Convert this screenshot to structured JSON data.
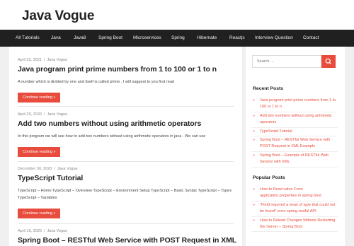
{
  "site": {
    "title": "Java Vogue"
  },
  "nav": {
    "items": [
      {
        "label": "All Tutorials",
        "name": "nav-item-all-tutorials"
      },
      {
        "label": "Java",
        "name": "nav-item-java"
      },
      {
        "label": "Java8",
        "name": "nav-item-java8"
      },
      {
        "label": "Spring Boot",
        "name": "nav-item-spring-boot"
      },
      {
        "label": "Microservices",
        "name": "nav-item-microservices"
      },
      {
        "label": "Spring",
        "name": "nav-item-spring"
      },
      {
        "label": "Hibernate",
        "name": "nav-item-hibernate"
      },
      {
        "label": "Reactjs",
        "name": "nav-item-reactjs"
      },
      {
        "label": "Interview Question",
        "name": "nav-item-interview-question"
      },
      {
        "label": "Contact",
        "name": "nav-item-contact"
      }
    ]
  },
  "posts": [
    {
      "date": "April 22, 2021",
      "author": "Java Vogue",
      "title": "Java program print prime numbers from 1 to 100 or 1 to n",
      "excerpt": "A number which is divided by one and itself is called prime . I will suggest to you first read",
      "more_label": "Continue reading »"
    },
    {
      "date": "April 20, 2020",
      "author": "Java Vogue",
      "title": "Add two numbers without using arithmetic operators",
      "excerpt": "In this program we will see how to add two numbers without using arithmetic operators in java . We can use",
      "more_label": "Continue reading »"
    },
    {
      "date": "December 30, 2020",
      "author": "Java Vogue",
      "title": "TypeScript Tutorial",
      "excerpt": "TypeScript – Home TypeScript – Overview TypeScript – Environment Setup TypeScript – Basic Syntax TypeScript – Types TypeScript – Variables",
      "more_label": "Continue reading »"
    },
    {
      "date": "April 19, 2020",
      "author": "Java Vogue",
      "title": "Spring Boot – RESTful Web Service with POST Request in XML"
    }
  ],
  "sidebar": {
    "search": {
      "placeholder": "Search ..."
    },
    "recent": {
      "title": "Recent Posts",
      "items": [
        "Java program print prime numbers from 1 to 100 or 1 to n",
        "Add two numbers without using arithmetic operators",
        "TypeScript Tutorial",
        "Spring Boot – RESTful Web Service with POST Request in XML Example",
        "Spring Boot – Example of RESTful Web Service with XML"
      ]
    },
    "popular": {
      "title": "Popular Posts",
      "items": [
        "How to Read value From application.properties in spring boot",
        "\"Field required a bean of type that could not be found\" error spring restful API",
        "How to Reload Changes Without Restarting the Server – Spring Boot"
      ]
    }
  },
  "colors": {
    "accent": "#e84c3d",
    "nav_bg": "#202020",
    "page_bg": "#f0f0f0"
  }
}
